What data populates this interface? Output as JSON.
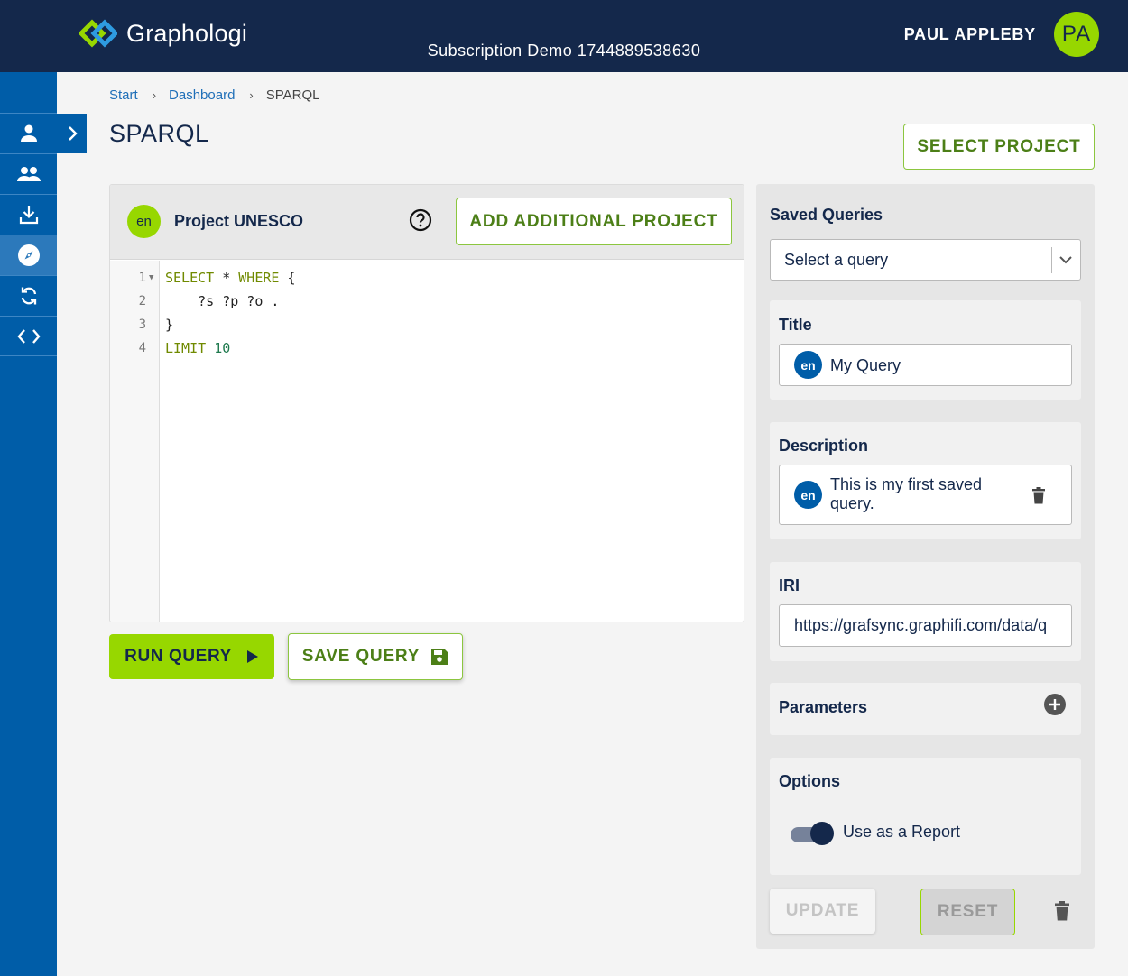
{
  "header": {
    "app_name": "Graphologi",
    "organization": "Subscription Demo 1744889538630",
    "user_name": "PAUL APPLEBY",
    "user_initials": "PA"
  },
  "sidebar": {
    "items": [
      {
        "icon": "person-icon"
      },
      {
        "icon": "people-icon"
      },
      {
        "icon": "download-icon"
      },
      {
        "icon": "compass-icon",
        "active": true
      },
      {
        "icon": "sync-icon"
      },
      {
        "icon": "code-icon"
      }
    ]
  },
  "breadcrumb": {
    "items": [
      "Start",
      "Dashboard",
      "SPARQL"
    ],
    "separator": "›"
  },
  "page": {
    "title": "SPARQL",
    "select_project_label": "SELECT PROJECT"
  },
  "editor": {
    "project_lang": "en",
    "project_name": "Project UNESCO",
    "add_project_label": "ADD ADDITIONAL PROJECT",
    "lines": [
      {
        "num": "1",
        "text": "SELECT * WHERE {"
      },
      {
        "num": "2",
        "text": "    ?s ?p ?o ."
      },
      {
        "num": "3",
        "text": "}"
      },
      {
        "num": "4",
        "text": "LIMIT 10"
      }
    ],
    "run_label": "RUN QUERY",
    "save_label": "SAVE QUERY"
  },
  "saved_queries": {
    "heading": "Saved Queries",
    "select_value": "Select a query",
    "title_label": "Title",
    "title_lang": "en",
    "title_value": "My Query",
    "description_label": "Description",
    "description_lang": "en",
    "description_value": "This is my first saved query.",
    "iri_label": "IRI",
    "iri_value": "https://grafsync.graphifi.com/data/q",
    "parameters_label": "Parameters",
    "options_label": "Options",
    "report_toggle_label": "Use as a Report",
    "report_toggle_on": true,
    "update_label": "UPDATE",
    "reset_label": "RESET"
  },
  "colors": {
    "navy": "#14284b",
    "brand_blue": "#005da8",
    "accent_green": "#97d700"
  }
}
